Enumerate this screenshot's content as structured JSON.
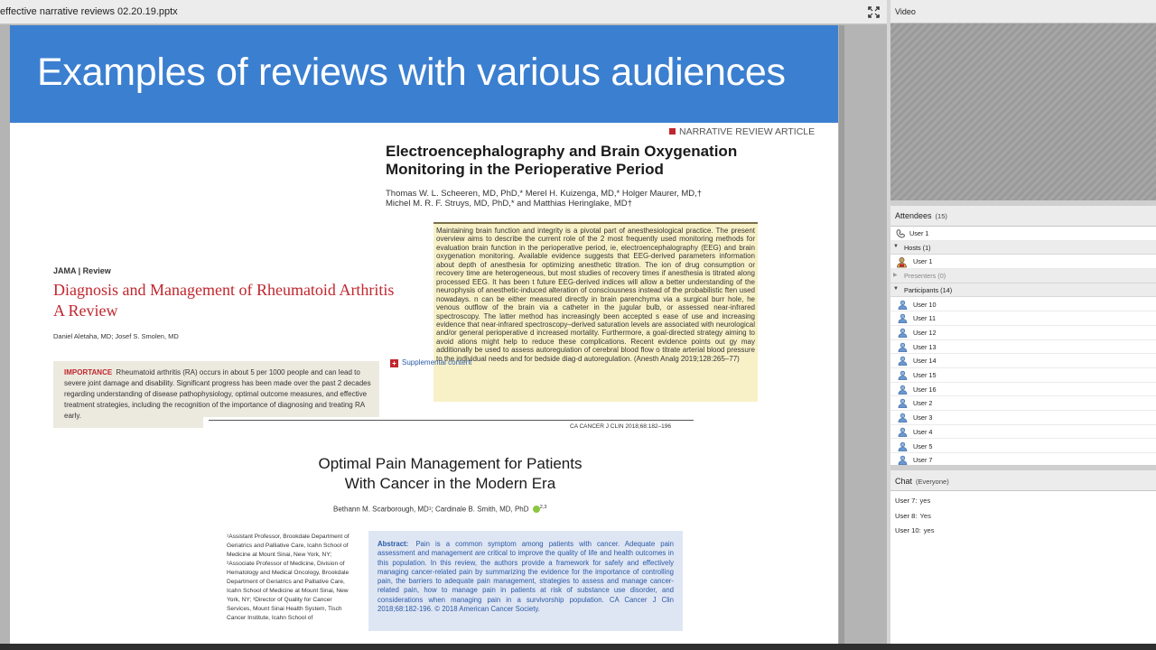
{
  "window": {
    "file_title": "effective narrative reviews 02.20.19.pptx"
  },
  "slide": {
    "title": "Examples of reviews with various audiences",
    "header_color": "#3b7fd0",
    "article1": {
      "tag": "NARRATIVE REVIEW ARTICLE",
      "title_line1": "Electroencephalography and Brain Oxygenation",
      "title_line2": "Monitoring in the Perioperative Period",
      "authors_line1": "Thomas W. L. Scheeren, MD, PhD,* Merel H. Kuizenga, MD,* Holger Maurer, MD,†",
      "authors_line2": "Michel M. R. F. Struys, MD, PhD,* and Matthias Heringlake, MD†",
      "abstract": "Maintaining brain function and integrity is a pivotal part of anesthesiological practice. The present overview aims to describe the current role of the 2 most frequently used monitoring methods for evaluation brain function in the perioperative period, ie, electroencephalography (EEG) and brain oxygenation monitoring. Available evidence suggests that EEG-derived parameters information about depth of anesthesia for optimizing anesthetic titration. The ion of drug consumption or recovery time are heterogeneous, but most studies of recovery times if anesthesia is titrated along processed EEG. It has been t future EEG-derived indices will allow a better understanding of the neurophysis of anesthetic-induced alteration of consciousness instead of the probabilistic ften used nowadays. n can be either measured directly in brain parenchyma via a surgical burr hole, he venous outflow of the brain via a catheter in the jugular bulb, or assessed near-infrared spectroscopy. The latter method has increasingly been accepted s ease of use and increasing evidence that near-infrared spectroscopy–derived saturation levels are associated with neurological and/or general perioperative d increased mortality. Furthermore, a goal-directed strategy aiming to avoid ations might help to reduce these complications. Recent evidence points out gy may additionally be used to assess autoregulation of cerebral blood flow o titrate arterial blood pressure to the individual needs and for bedside diag-d autoregulation. (Anesth Analg 2019;128:265–77)"
    },
    "article2": {
      "journal": "JAMA | Review",
      "title": "Diagnosis and Management of Rheumatoid Arthritis",
      "subtitle": "A Review",
      "authors": "Daniel Aletaha, MD; Josef S. Smolen, MD",
      "supplemental": "Supplemental content",
      "importance_label": "IMPORTANCE",
      "importance_text": "Rheumatoid arthritis (RA) occurs in about 5 per 1000 people and can lead to severe joint damage and disability. Significant progress has been made over the past 2 decades regarding understanding of disease pathophysiology, optimal outcome measures, and effective treatment strategies, including the recognition of the importance of diagnosing and treating RA early."
    },
    "article3": {
      "header": "CA CANCER J CLIN 2018;68:182–196",
      "title_line1": "Optimal Pain Management for Patients",
      "title_line2": "With Cancer in the Modern Era",
      "authors": "Bethann M. Scarborough, MD¹; Cardinale B. Smith, MD, PhD",
      "authors_sup": "2,3",
      "affiliations": "¹Assistant Professor, Brookdale Department of Geriatrics and Palliative Care, Icahn School of Medicine at Mount Sinai, New York, NY; ²Associate Professor of Medicine, Division of Hematology and Medical Oncology, Brookdale Department of Geriatrics and Palliative Care, Icahn School of Medicine at Mount Sinai, New York, NY; ³Director of Quality for Cancer Services, Mount Sinai Health System, Tisch Cancer Institute, Icahn School of",
      "abstract_label": "Abstract:",
      "abstract_text": "Pain is a common symptom among patients with cancer. Adequate pain assessment and management are critical to improve the quality of life and health outcomes in this population. In this review, the authors provide a framework for safely and effectively managing cancer-related pain by summarizing the evidence for the importance of controlling pain, the barriers to adequate pain management, strategies to assess and manage cancer-related pain, how to manage pain in patients at risk of substance use disorder, and considerations when managing pain in a survivorship population. CA Cancer J Clin 2018;68:182-196. © 2018 American Cancer Society."
    }
  },
  "video_pod": {
    "title": "Video"
  },
  "attendees_pod": {
    "title": "Attendees",
    "count": "(15)",
    "me": "User 1",
    "hosts_label": "Hosts (1)",
    "hosts": [
      "User 1"
    ],
    "presenters_label": "Presenters (0)",
    "participants_label": "Participants (14)",
    "participants": [
      "User 10",
      "User 11",
      "User 12",
      "User 13",
      "User 14",
      "User 15",
      "User 16",
      "User 2",
      "User 3",
      "User 4",
      "User 5",
      "User 7"
    ]
  },
  "chat_pod": {
    "title": "Chat",
    "scope": "(Everyone)",
    "messages": [
      {
        "who": "User 7:",
        "text": "yes"
      },
      {
        "who": "User 8:",
        "text": "Yes"
      },
      {
        "who": "User 10:",
        "text": "yes"
      }
    ]
  }
}
